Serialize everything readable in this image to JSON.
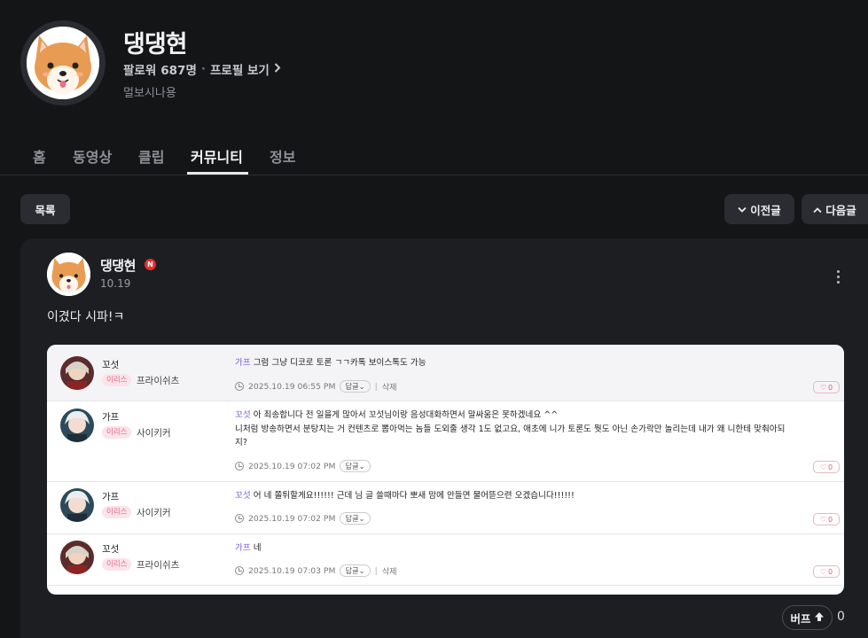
{
  "profile": {
    "name": "댕댕현",
    "followers_label": "팔로워",
    "followers_count": "687명",
    "separator": "·",
    "profile_link": "프로필 보기",
    "description": "멀보시나용"
  },
  "tabs": [
    "홈",
    "동영상",
    "클립",
    "커뮤니티",
    "정보"
  ],
  "active_tab": "커뮤니티",
  "nav": {
    "list": "목록",
    "prev": "이전글",
    "next": "다음글"
  },
  "post": {
    "author": "댕댕현",
    "badge": "N",
    "date": "10.19",
    "text": "이겼다 시파!ㅋ"
  },
  "comments": [
    {
      "name": "꼬섯",
      "tag": "이리스",
      "role": "프라이쉬츠",
      "mention": "가프",
      "text": "그럼 그냥 디코로 토론 ㄱㄱ카톡 보이스톡도 가능",
      "time": "2025.10.19 06:55 PM",
      "reply": "답글",
      "delete": "삭제",
      "likes": "0"
    },
    {
      "name": "가프",
      "tag": "이리스",
      "role": "사이키커",
      "mention": "꼬섯",
      "text": "아 죄송합니다 전 일을게 많아서 꼬섯님이랑 음성대화하면서 말싸움은 못하겠네요 ^^",
      "text2": "니처럼 방송하면서 분탕치는 거 컨텐츠로 뽑아먹는 놈들 도외줄 생각 1도 없고요, 애초에 니가 토론도 뭣도 아닌 손가락만 놀리는데 내가 왜 니한테 맞춰아되",
      "text3": "지?",
      "time": "2025.10.19 07:02 PM",
      "reply": "답글",
      "likes": "0"
    },
    {
      "name": "가프",
      "tag": "이리스",
      "role": "사이키커",
      "mention": "꼬섯",
      "text": "어 네 쫄튀할게요!!!!!! 근데 님 글 쓸때마다 뽀새 맘에 안들면 물어뜯으련 오겠습니다!!!!!!",
      "time": "2025.10.19 07:02 PM",
      "reply": "답글",
      "likes": "0"
    },
    {
      "name": "꼬섯",
      "tag": "이리스",
      "role": "프라이쉬츠",
      "mention": "가프",
      "text": "네",
      "time": "2025.10.19 07:03 PM",
      "reply": "답글",
      "delete": "삭제",
      "likes": "0"
    }
  ],
  "buff": {
    "label": "버프",
    "count": "0"
  },
  "colors": {
    "background": "#141517",
    "card": "#1d1e22",
    "mention": "#7a58e0",
    "badge": "#e52e2e"
  }
}
